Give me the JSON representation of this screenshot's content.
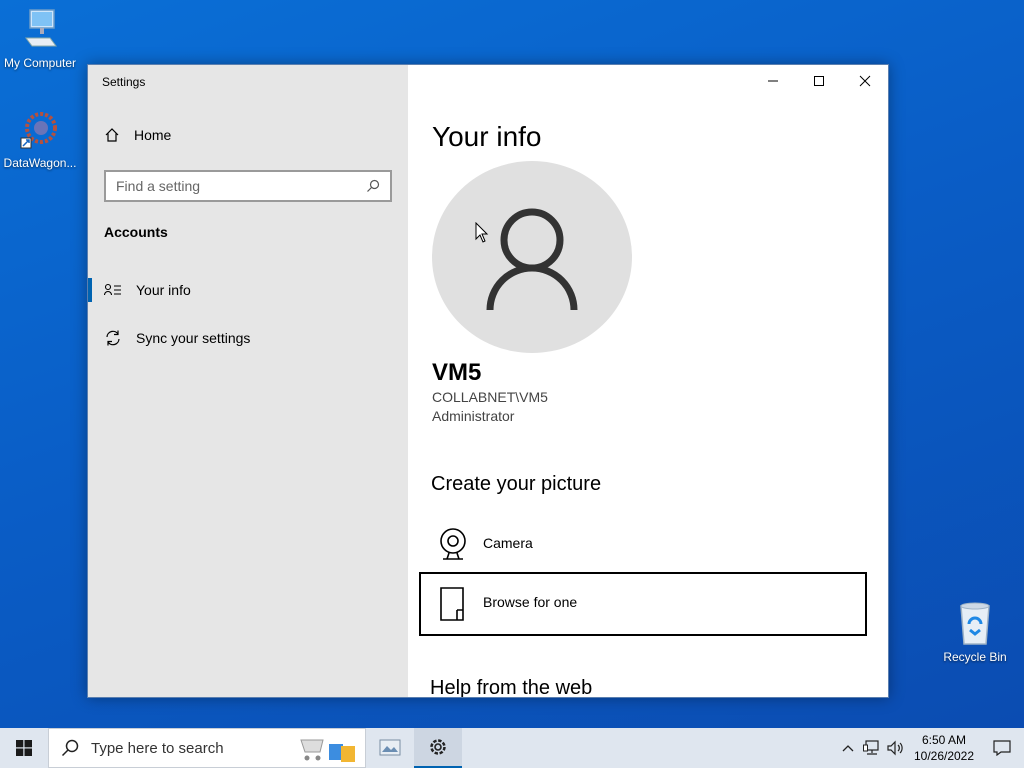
{
  "desktop": {
    "icons": [
      {
        "label": "My Computer"
      },
      {
        "label": "DataWagon..."
      },
      {
        "label": "Recycle Bin"
      }
    ]
  },
  "window": {
    "title": "Settings",
    "sidebar": {
      "home_label": "Home",
      "search_placeholder": "Find a setting",
      "section_heading": "Accounts",
      "items": [
        {
          "label": "Your info",
          "active": true
        },
        {
          "label": "Sync your settings",
          "active": false
        }
      ]
    },
    "main": {
      "title": "Your info",
      "user_name": "VM5",
      "user_domain": "COLLABNET\\VM5",
      "user_role": "Administrator",
      "create_picture_heading": "Create your picture",
      "options": [
        {
          "label": "Camera"
        },
        {
          "label": "Browse for one"
        }
      ],
      "help_heading": "Help from the web"
    }
  },
  "taskbar": {
    "search_placeholder": "Type here to search",
    "time": "6:50 AM",
    "date": "10/26/2022"
  },
  "colors": {
    "accent": "#0063b1",
    "desktop": "#0a5dc6"
  }
}
